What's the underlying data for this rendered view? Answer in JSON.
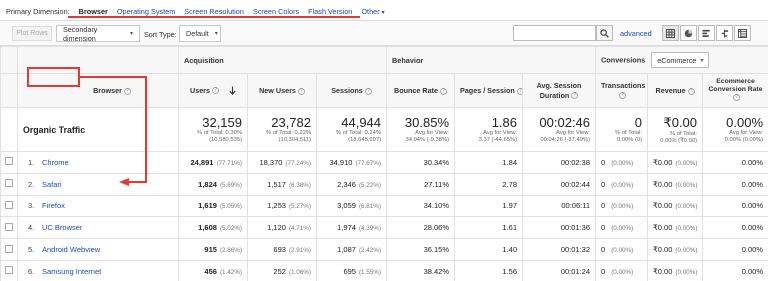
{
  "primary_dimension": {
    "label": "Primary Dimension:",
    "options": [
      "Browser",
      "Operating System",
      "Screen Resolution",
      "Screen Colors",
      "Flash Version",
      "Other"
    ],
    "active": "Browser"
  },
  "toolbar": {
    "plot_rows": "Plot Rows",
    "secondary_dimension": "Secondary dimension",
    "sort_type_label": "Sort Type:",
    "sort_type_value": "Default",
    "search_placeholder": "",
    "advanced": "advanced"
  },
  "groups": {
    "acquisition": "Acquisition",
    "behavior": "Behavior",
    "conversions": "Conversions",
    "conversions_select": "eCommerce"
  },
  "columns": {
    "browser": "Browser",
    "users": "Users",
    "new_users": "New Users",
    "sessions": "Sessions",
    "bounce_rate": "Bounce Rate",
    "pages_session": "Pages / Session",
    "avg_session_duration": "Avg. Session Duration",
    "transactions": "Transactions",
    "revenue": "Revenue",
    "ecom_conv_rate": "Ecommerce Conversion Rate"
  },
  "totals": {
    "label": "Organic Traffic",
    "users": {
      "value": "32,159",
      "l1": "% of Total: 0.30%",
      "l2": "(10,580,535)"
    },
    "new_users": {
      "value": "23,782",
      "l1": "% of Total: 0.22%",
      "l2": "(10,304,511)"
    },
    "sessions": {
      "value": "44,944",
      "l1": "% of Total: 0.24%",
      "l2": "(18,645,697)"
    },
    "bounce_rate": {
      "value": "30.85%",
      "l1": "Avg for View:",
      "l2": "34.04% (-9.38%)"
    },
    "pages_session": {
      "value": "1.86",
      "l1": "Avg for View:",
      "l2": "3.37 (-44.65%)"
    },
    "avg_session_duration": {
      "value": "00:02:46",
      "l1": "Avg for View:",
      "l2": "00:04:26 (-37.49%)"
    },
    "transactions": {
      "value": "0",
      "l1": "% of Total:",
      "l2": "0.00% (0)"
    },
    "revenue": {
      "value": "₹0.00",
      "l1": "% of Total:",
      "l2": "0.00% (₹0.00)"
    },
    "ecom_conv_rate": {
      "value": "0.00%",
      "l1": "Avg for View:",
      "l2": "0.00% (0.00%)"
    }
  },
  "rows": [
    {
      "idx": "1.",
      "browser": "Chrome",
      "users": "24,891",
      "users_pct": "(77.71%)",
      "new_users": "18,370",
      "new_users_pct": "(77.24%)",
      "sessions": "34,910",
      "sessions_pct": "(77.67%)",
      "bounce": "30.34%",
      "pages": "1.84",
      "duration": "00:02:38",
      "trans": "0",
      "trans_pct": "(0.00%)",
      "revenue": "₹0.00",
      "revenue_pct": "(0.00%)",
      "conv": "0.00%"
    },
    {
      "idx": "2.",
      "browser": "Safari",
      "users": "1,824",
      "users_pct": "(5.69%)",
      "new_users": "1,517",
      "new_users_pct": "(6.38%)",
      "sessions": "2,346",
      "sessions_pct": "(5.22%)",
      "bounce": "27.11%",
      "pages": "2.78",
      "duration": "00:02:44",
      "trans": "0",
      "trans_pct": "(0.00%)",
      "revenue": "₹0.00",
      "revenue_pct": "(0.00%)",
      "conv": "0.00%"
    },
    {
      "idx": "3.",
      "browser": "Firefox",
      "users": "1,619",
      "users_pct": "(5.05%)",
      "new_users": "1,253",
      "new_users_pct": "(5.27%)",
      "sessions": "3,059",
      "sessions_pct": "(6.81%)",
      "bounce": "34.10%",
      "pages": "1.97",
      "duration": "00:06:11",
      "trans": "0",
      "trans_pct": "(0.00%)",
      "revenue": "₹0.00",
      "revenue_pct": "(0.00%)",
      "conv": "0.00%"
    },
    {
      "idx": "4.",
      "browser": "UC Browser",
      "users": "1,608",
      "users_pct": "(5.02%)",
      "new_users": "1,120",
      "new_users_pct": "(4.71%)",
      "sessions": "1,974",
      "sessions_pct": "(4.39%)",
      "bounce": "28.06%",
      "pages": "1.61",
      "duration": "00:01:36",
      "trans": "0",
      "trans_pct": "(0.00%)",
      "revenue": "₹0.00",
      "revenue_pct": "(0.00%)",
      "conv": "0.00%"
    },
    {
      "idx": "5.",
      "browser": "Android Webview",
      "users": "915",
      "users_pct": "(2.86%)",
      "new_users": "693",
      "new_users_pct": "(2.91%)",
      "sessions": "1,087",
      "sessions_pct": "(2.42%)",
      "bounce": "36.15%",
      "pages": "1.40",
      "duration": "00:01:32",
      "trans": "0",
      "trans_pct": "(0.00%)",
      "revenue": "₹0.00",
      "revenue_pct": "(0.00%)",
      "conv": "0.00%"
    },
    {
      "idx": "6.",
      "browser": "Samsung Internet",
      "users": "456",
      "users_pct": "(1.42%)",
      "new_users": "252",
      "new_users_pct": "(1.06%)",
      "sessions": "695",
      "sessions_pct": "(1.55%)",
      "bounce": "38.42%",
      "pages": "1.56",
      "duration": "00:01:24",
      "trans": "0",
      "trans_pct": "(0.00%)",
      "revenue": "₹0.00",
      "revenue_pct": "(0.00%)",
      "conv": "0.00%"
    }
  ],
  "icons": {
    "search": "search-icon",
    "views": [
      "table-view-icon",
      "pie-view-icon",
      "bar-view-icon",
      "comparison-view-icon",
      "pivot-view-icon"
    ],
    "sort": "sort-down-arrow-icon",
    "help": "help-icon"
  },
  "colors": {
    "link": "#1a4bb8",
    "annotation": "#e53935"
  }
}
